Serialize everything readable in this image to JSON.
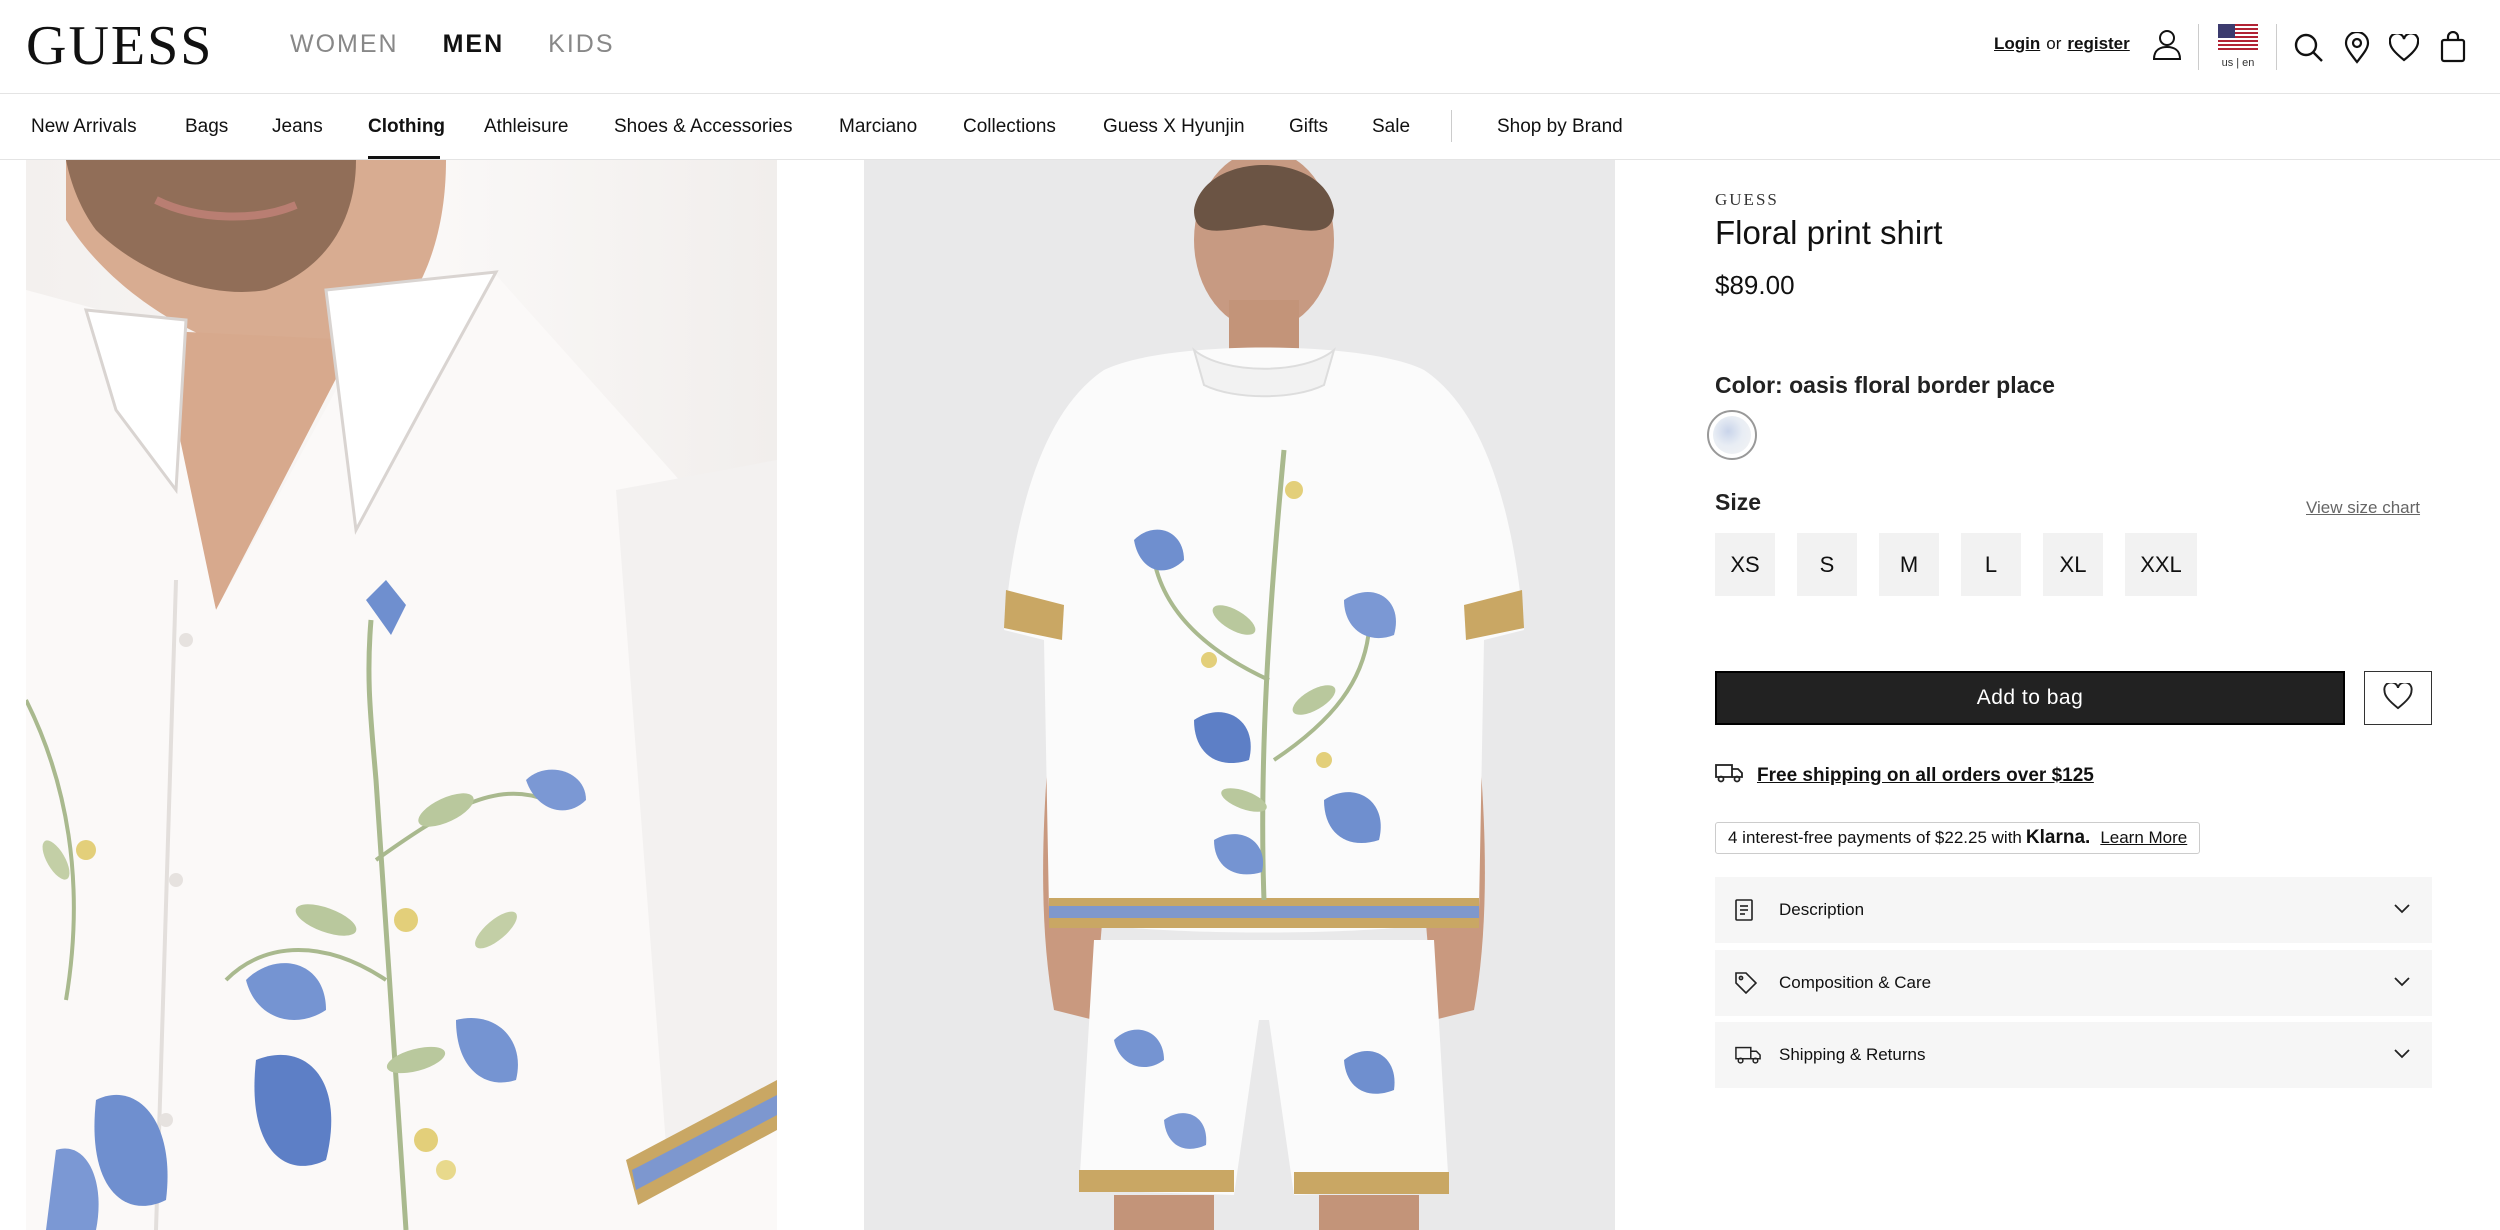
{
  "header": {
    "logo": "GUESS",
    "gender_tabs": [
      {
        "label": "WOMEN",
        "active": false
      },
      {
        "label": "MEN",
        "active": true
      },
      {
        "label": "KIDS",
        "active": false
      }
    ],
    "login_label": "Login",
    "or_label": "or",
    "register_label": "register",
    "locale": "us | en",
    "icons": [
      "account-icon",
      "us-flag-icon",
      "search-icon",
      "store-locator-icon",
      "wishlist-icon",
      "bag-icon"
    ]
  },
  "category_nav": {
    "items": [
      {
        "label": "New Arrivals",
        "active": false
      },
      {
        "label": "Bags",
        "active": false
      },
      {
        "label": "Jeans",
        "active": false
      },
      {
        "label": "Clothing",
        "active": true
      },
      {
        "label": "Athleisure",
        "active": false
      },
      {
        "label": "Shoes & Accessories",
        "active": false
      },
      {
        "label": "Marciano",
        "active": false
      },
      {
        "label": "Collections",
        "active": false
      },
      {
        "label": "Guess X Hyunjin",
        "active": false
      },
      {
        "label": "Gifts",
        "active": false
      },
      {
        "label": "Sale",
        "active": false
      }
    ],
    "shop_by_brand": "Shop by Brand"
  },
  "product": {
    "brand": "GUESS",
    "title": "Floral print shirt",
    "price": "$89.00",
    "color_label": "Color: oasis floral border place",
    "size_label": "Size",
    "size_chart_link": "View size chart",
    "sizes": [
      "XS",
      "S",
      "M",
      "L",
      "XL",
      "XXL"
    ],
    "add_to_bag": "Add to bag",
    "shipping_text": "Free shipping on all orders over $125",
    "klarna": {
      "prefix": "4 interest-free payments of $22.25 with",
      "brand": "Klarna.",
      "learn_more": "Learn More"
    },
    "accordions": [
      {
        "label": "Description",
        "icon": "document-icon"
      },
      {
        "label": "Composition & Care",
        "icon": "tag-icon"
      },
      {
        "label": "Shipping & Returns",
        "icon": "truck-icon"
      }
    ]
  },
  "colors": {
    "text": "#111111",
    "button_bg": "#222222",
    "accordion_bg": "#f6f6f6",
    "size_bg": "#f2f2f2",
    "shirt_blue": "#6f8fcf",
    "leaf_green": "#a9b98e"
  }
}
